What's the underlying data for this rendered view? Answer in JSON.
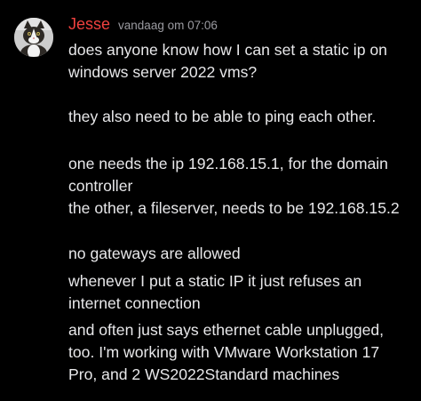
{
  "message": {
    "author": {
      "name": "Jesse",
      "name_color": "#f0413f",
      "avatar_icon": "cat-avatar"
    },
    "timestamp": "vandaag om 07:06",
    "lines": [
      "does anyone know how I can set a static ip on",
      "windows server 2022 vms?",
      "they also need to be able to ping each other.",
      "one needs the ip 192.168.15.1, for the domain",
      "controller",
      "the other, a fileserver, needs to be 192.168.15.2",
      "no gateways are allowed",
      "whenever I put a static IP it just refuses an",
      "internet connection",
      "and often just says ethernet cable unplugged,",
      "too. I'm working with VMware Workstation 17",
      "Pro, and 2 WS2022Standard machines"
    ]
  },
  "theme": {
    "background": "#000000",
    "text_color": "#e8e8ea",
    "timestamp_color": "#9b9ba1"
  }
}
